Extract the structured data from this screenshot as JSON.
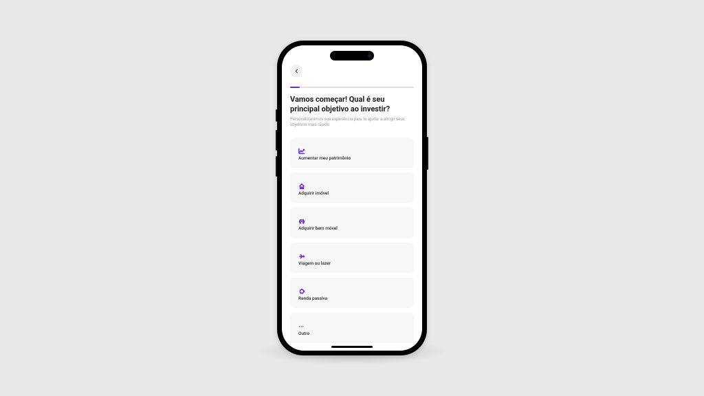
{
  "header": {
    "title": "Vamos começar! Qual é seu principal objetivo ao investir?",
    "subtitle": "Personalizaremos sua experiência para te ajudar a atingir seus objetivos mais rápido"
  },
  "progress": {
    "percent": 8
  },
  "options": [
    {
      "icon": "chart-up-icon",
      "label": "Aumentar meu patrimônio"
    },
    {
      "icon": "house-icon",
      "label": "Adquirir imóvel"
    },
    {
      "icon": "car-icon",
      "label": "Adquirir bem móvel"
    },
    {
      "icon": "plane-icon",
      "label": "Viagem ou lazer"
    },
    {
      "icon": "piggy-icon",
      "label": "Renda passiva"
    },
    {
      "icon": "dots-icon",
      "label": "Outro"
    }
  ],
  "colors": {
    "accent": "#6b2fd6",
    "background": "#e8e8e8",
    "card": "#f7f7f8"
  }
}
